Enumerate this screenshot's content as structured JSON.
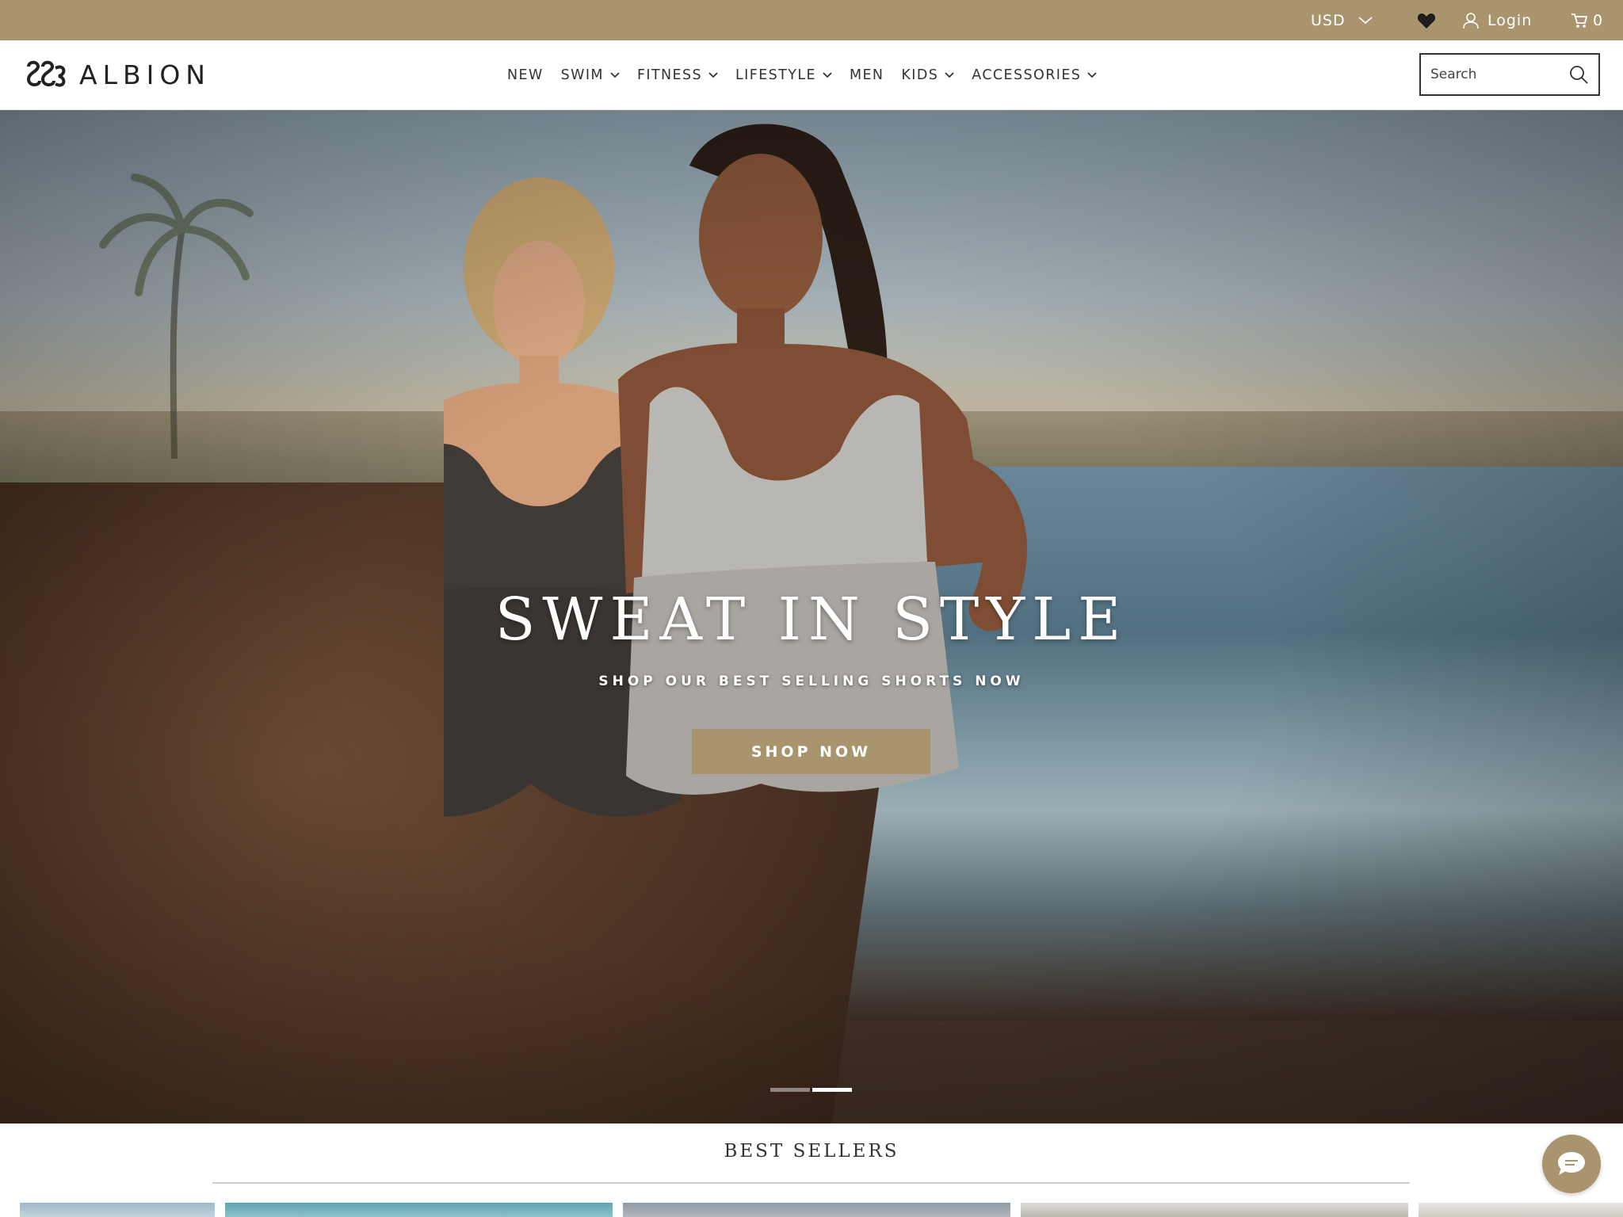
{
  "topbar": {
    "currency": "USD",
    "login_label": "Login",
    "cart_count": "0"
  },
  "header": {
    "brand": "ALBION",
    "nav": [
      {
        "label": "NEW",
        "has_dropdown": false
      },
      {
        "label": "SWIM",
        "has_dropdown": true
      },
      {
        "label": "FITNESS",
        "has_dropdown": true
      },
      {
        "label": "LIFESTYLE",
        "has_dropdown": true
      },
      {
        "label": "MEN",
        "has_dropdown": false
      },
      {
        "label": "KIDS",
        "has_dropdown": true
      },
      {
        "label": "ACCESSORIES",
        "has_dropdown": true
      }
    ],
    "search_placeholder": "Search"
  },
  "hero": {
    "title": "SWEAT IN STYLE",
    "subtitle": "SHOP OUR BEST SELLING SHORTS NOW",
    "cta": "SHOP NOW",
    "slides_total": 2,
    "active_slide": 2
  },
  "best_sellers": {
    "title": "BEST SELLERS"
  },
  "colors": {
    "accent": "#a8946d",
    "text": "#222222"
  },
  "icons": [
    "chevron-down-icon",
    "heart-icon",
    "user-icon",
    "cart-icon",
    "search-icon",
    "chat-icon"
  ]
}
